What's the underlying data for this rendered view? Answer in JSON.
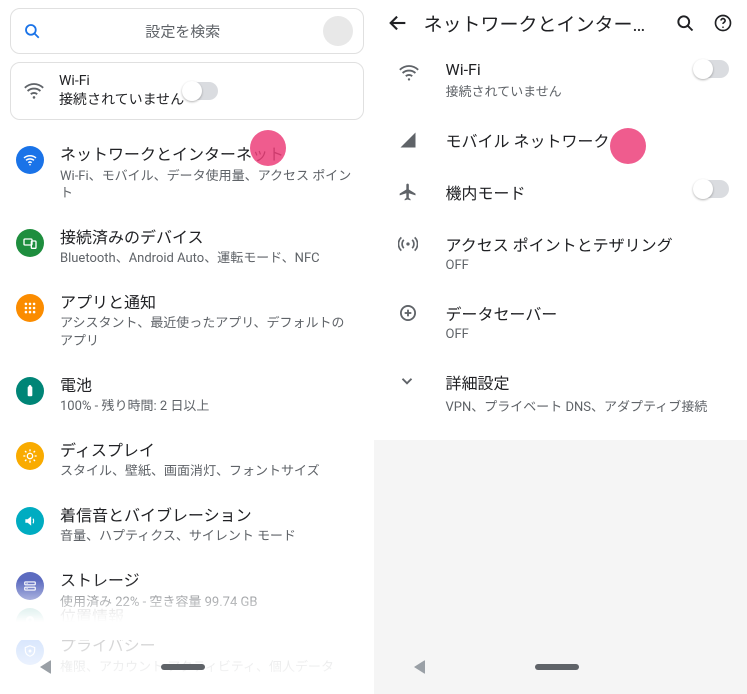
{
  "left": {
    "search_placeholder": "設定を検索",
    "wifi_card": {
      "title": "Wi-Fi",
      "sub": "接続されていません"
    },
    "items": [
      {
        "title": "ネットワークとインターネット",
        "sub": "Wi-Fi、モバイル、データ使用量、アクセス ポイント"
      },
      {
        "title": "接続済みのデバイス",
        "sub": "Bluetooth、Android Auto、運転モード、NFC"
      },
      {
        "title": "アプリと通知",
        "sub": "アシスタント、最近使ったアプリ、デフォルトのアプリ"
      },
      {
        "title": "電池",
        "sub": "100% - 残り時間: 2 日以上"
      },
      {
        "title": "ディスプレイ",
        "sub": "スタイル、壁紙、画面消灯、フォントサイズ"
      },
      {
        "title": "着信音とバイブレーション",
        "sub": "音量、ハプティクス、サイレント モード"
      },
      {
        "title": "ストレージ",
        "sub": "使用済み 22% - 空き容量 99.74 GB"
      },
      {
        "title": "プライバシー",
        "sub": "権限、アカウント アクティビティ、個人データ"
      }
    ],
    "faded": {
      "title": "位置情報"
    }
  },
  "right": {
    "title": "ネットワークとインター…",
    "wifi": {
      "title": "Wi-Fi",
      "sub": "接続されていません"
    },
    "items": [
      {
        "title": "モバイル ネットワーク",
        "sub": ""
      },
      {
        "title": "機内モード",
        "sub": ""
      },
      {
        "title": "アクセス ポイントとテザリング",
        "sub": "OFF"
      },
      {
        "title": "データセーバー",
        "sub": "OFF"
      },
      {
        "title": "詳細設定",
        "sub": "VPN、プライベート DNS、アダプティブ接続"
      }
    ]
  }
}
